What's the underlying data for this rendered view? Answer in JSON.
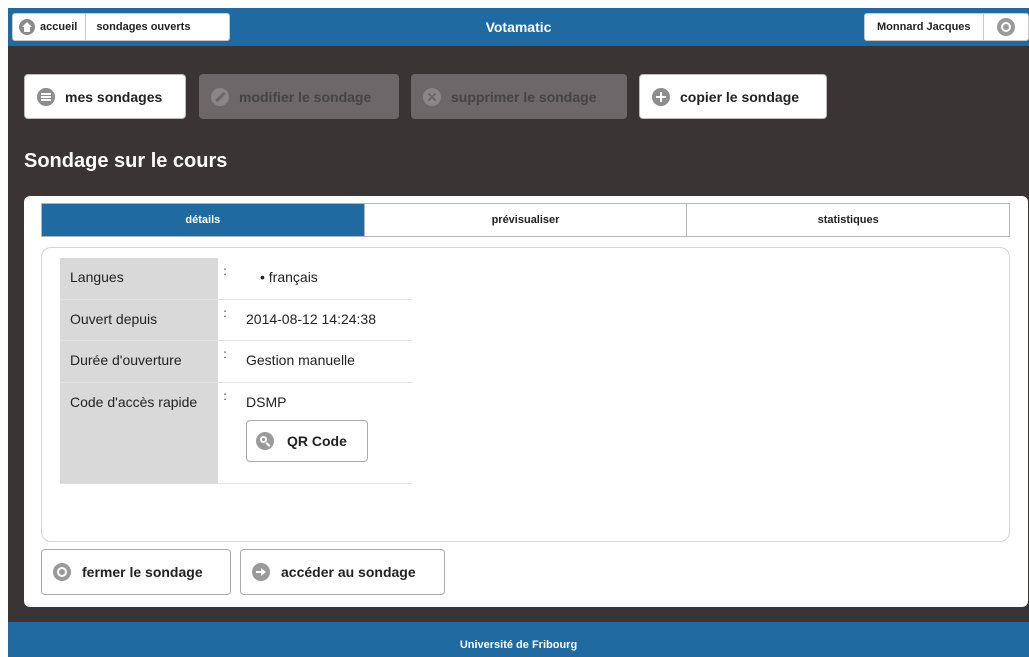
{
  "topbar": {
    "home_label": "accueil",
    "open_polls_label": "sondages ouverts",
    "app_title": "Votamatic",
    "user_name": "Monnard Jacques",
    "settings_icon": "gear-icon"
  },
  "actions": {
    "my_polls": "mes sondages",
    "edit_poll": "modifier le sondage",
    "delete_poll": "supprimer le sondage",
    "copy_poll": "copier le sondage"
  },
  "survey": {
    "title": "Sondage sur le cours"
  },
  "tabs": [
    {
      "label": "détails",
      "active": true
    },
    {
      "label": "prévisualiser",
      "active": false
    },
    {
      "label": "statistiques",
      "active": false
    }
  ],
  "details": {
    "separator": ":",
    "rows": [
      {
        "label": "Langues",
        "value": "• français"
      },
      {
        "label": "Ouvert depuis",
        "value": "2014-08-12 14:24:38"
      },
      {
        "label": "Durée d'ouverture",
        "value": "Gestion manuelle"
      },
      {
        "label": "Code d'accès rapide",
        "value": "DSMP"
      }
    ],
    "qr_button": "QR Code"
  },
  "bottom_actions": {
    "close_poll": "fermer le sondage",
    "access_poll": "accéder au sondage"
  },
  "footer": {
    "text": "Université de Fribourg"
  },
  "colors": {
    "brand_blue": "#1f6aa0",
    "background_dark": "#3a3435",
    "disabled_button": "#6c6869"
  }
}
